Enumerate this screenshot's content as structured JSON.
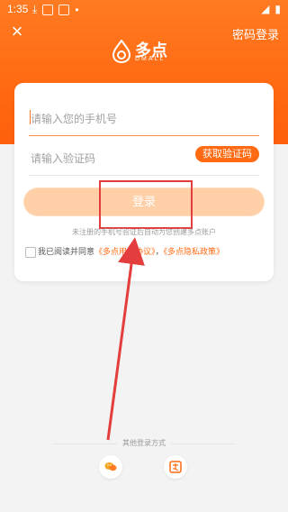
{
  "status_bar": {
    "time": "1:35"
  },
  "header": {
    "password_login": "密码登录",
    "brand_cn": "多点",
    "brand_en": "DMALL"
  },
  "form": {
    "phone_placeholder": "请输入您的手机号",
    "code_placeholder": "请输入验证码",
    "get_code_label": "获取验证码",
    "login_label": "登录",
    "hint": "未注册的手机号验证后自动为您创建多点账户"
  },
  "agreement": {
    "prefix": "我已阅读并同意",
    "link1": "《多点用户协议》",
    "sep": "，",
    "link2": "《多点隐私政策》"
  },
  "other_login": {
    "title": "其他登录方式"
  },
  "colors": {
    "brand_orange": "#ff6a12",
    "button_disabled": "#ffcfa8",
    "annotation_red": "#e33d3d"
  }
}
